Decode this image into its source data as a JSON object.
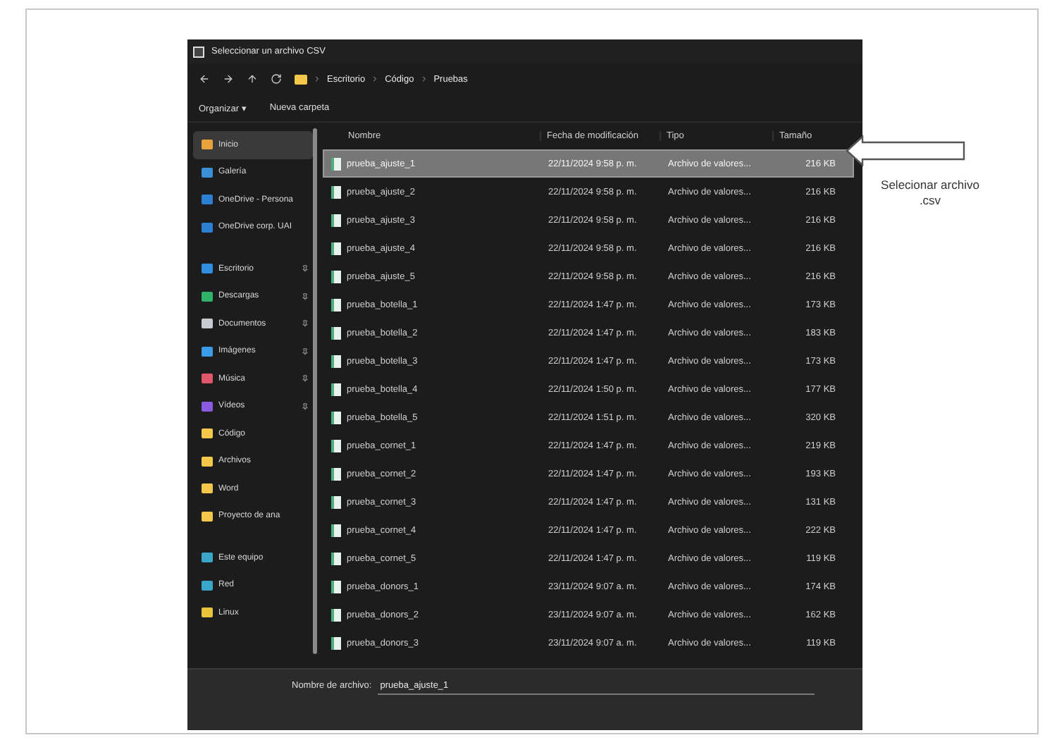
{
  "window": {
    "title": "Seleccionar un archivo CSV"
  },
  "address_bar": {
    "path": [
      "Escritorio",
      "Código",
      "Pruebas"
    ]
  },
  "toolbar": {
    "organize": "Organizar ▾",
    "new_folder": "Nueva carpeta"
  },
  "sidebar": {
    "sections": [
      [
        {
          "label": "Inicio",
          "color": "#e8a33c",
          "selected": true,
          "pinned": false
        },
        {
          "label": "Galería",
          "color": "#3b8fd9",
          "selected": false,
          "pinned": false
        },
        {
          "label": "OneDrive - Persona",
          "color": "#2d7fd3",
          "selected": false,
          "pinned": false
        },
        {
          "label": "OneDrive corp. UAI",
          "color": "#2d7fd3",
          "selected": false,
          "pinned": false
        }
      ],
      [
        {
          "label": "Escritorio",
          "color": "#2f8fe0",
          "selected": false,
          "pinned": true
        },
        {
          "label": "Descargas",
          "color": "#2fb36a",
          "selected": false,
          "pinned": true
        },
        {
          "label": "Documentos",
          "color": "#c8ccd2",
          "selected": false,
          "pinned": true
        },
        {
          "label": "Imágenes",
          "color": "#3a9be6",
          "selected": false,
          "pinned": true
        },
        {
          "label": "Música",
          "color": "#e0566a",
          "selected": false,
          "pinned": true
        },
        {
          "label": "Vídeos",
          "color": "#8a5be0",
          "selected": false,
          "pinned": true
        },
        {
          "label": "Código",
          "color": "#f2c74a",
          "selected": false,
          "pinned": false
        },
        {
          "label": "Archivos",
          "color": "#f2c74a",
          "selected": false,
          "pinned": false
        },
        {
          "label": "Word",
          "color": "#f2c74a",
          "selected": false,
          "pinned": false
        },
        {
          "label": "Proyecto de ana",
          "color": "#f2c74a",
          "selected": false,
          "pinned": false
        }
      ],
      [
        {
          "label": "Este equipo",
          "color": "#3aa6c9",
          "selected": false,
          "pinned": false
        },
        {
          "label": "Red",
          "color": "#3aa6c9",
          "selected": false,
          "pinned": false
        },
        {
          "label": "Linux",
          "color": "#e8c43c",
          "selected": false,
          "pinned": false
        }
      ]
    ]
  },
  "table": {
    "columns": [
      "Nombre",
      "Fecha de modificación",
      "Tipo",
      "Tamaño"
    ],
    "rows": [
      {
        "name": "prueba_ajuste_1",
        "date": "22/11/2024 9:58 p. m.",
        "type": "Archivo de valores...",
        "size": "216 KB",
        "selected": true
      },
      {
        "name": "prueba_ajuste_2",
        "date": "22/11/2024 9:58 p. m.",
        "type": "Archivo de valores...",
        "size": "216 KB",
        "selected": false
      },
      {
        "name": "prueba_ajuste_3",
        "date": "22/11/2024 9:58 p. m.",
        "type": "Archivo de valores...",
        "size": "216 KB",
        "selected": false
      },
      {
        "name": "prueba_ajuste_4",
        "date": "22/11/2024 9:58 p. m.",
        "type": "Archivo de valores...",
        "size": "216 KB",
        "selected": false
      },
      {
        "name": "prueba_ajuste_5",
        "date": "22/11/2024 9:58 p. m.",
        "type": "Archivo de valores...",
        "size": "216 KB",
        "selected": false
      },
      {
        "name": "prueba_botella_1",
        "date": "22/11/2024 1:47 p. m.",
        "type": "Archivo de valores...",
        "size": "173 KB",
        "selected": false
      },
      {
        "name": "prueba_botella_2",
        "date": "22/11/2024 1:47 p. m.",
        "type": "Archivo de valores...",
        "size": "183 KB",
        "selected": false
      },
      {
        "name": "prueba_botella_3",
        "date": "22/11/2024 1:47 p. m.",
        "type": "Archivo de valores...",
        "size": "173 KB",
        "selected": false
      },
      {
        "name": "prueba_botella_4",
        "date": "22/11/2024 1:50 p. m.",
        "type": "Archivo de valores...",
        "size": "177 KB",
        "selected": false
      },
      {
        "name": "prueba_botella_5",
        "date": "22/11/2024 1:51 p. m.",
        "type": "Archivo de valores...",
        "size": "320 KB",
        "selected": false
      },
      {
        "name": "prueba_cornet_1",
        "date": "22/11/2024 1:47 p. m.",
        "type": "Archivo de valores...",
        "size": "219 KB",
        "selected": false
      },
      {
        "name": "prueba_cornet_2",
        "date": "22/11/2024 1:47 p. m.",
        "type": "Archivo de valores...",
        "size": "193 KB",
        "selected": false
      },
      {
        "name": "prueba_cornet_3",
        "date": "22/11/2024 1:47 p. m.",
        "type": "Archivo de valores...",
        "size": "131 KB",
        "selected": false
      },
      {
        "name": "prueba_cornet_4",
        "date": "22/11/2024 1:47 p. m.",
        "type": "Archivo de valores...",
        "size": "222 KB",
        "selected": false
      },
      {
        "name": "prueba_cornet_5",
        "date": "22/11/2024 1:47 p. m.",
        "type": "Archivo de valores...",
        "size": "119 KB",
        "selected": false
      },
      {
        "name": "prueba_donors_1",
        "date": "23/11/2024 9:07 a. m.",
        "type": "Archivo de valores...",
        "size": "174 KB",
        "selected": false
      },
      {
        "name": "prueba_donors_2",
        "date": "23/11/2024 9:07 a. m.",
        "type": "Archivo de valores...",
        "size": "162 KB",
        "selected": false
      },
      {
        "name": "prueba_donors_3",
        "date": "23/11/2024 9:07 a. m.",
        "type": "Archivo de valores...",
        "size": "119 KB",
        "selected": false
      }
    ]
  },
  "footer": {
    "label": "Nombre de archivo:",
    "value": "prueba_ajuste_1"
  },
  "annotation": {
    "text": "Selecionar archivo .csv"
  }
}
